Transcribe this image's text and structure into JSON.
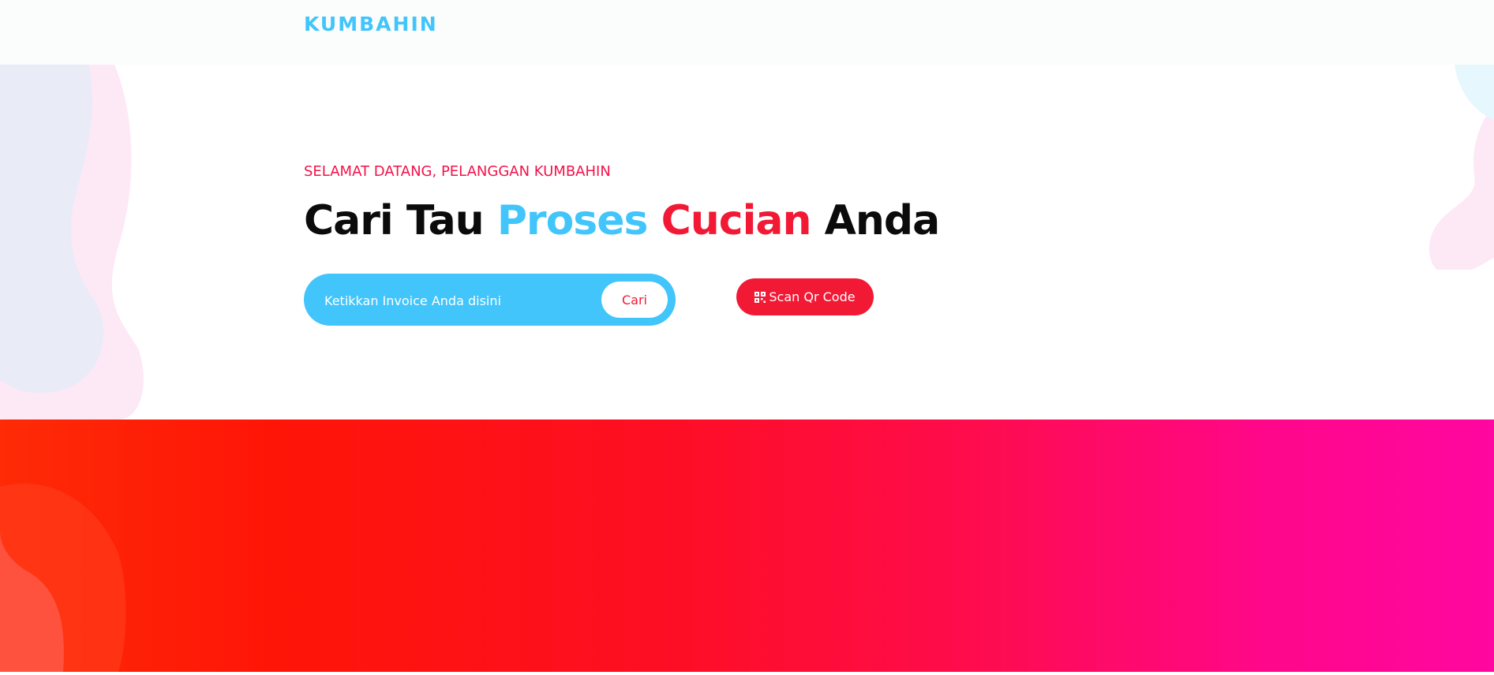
{
  "navbar": {
    "brand": "KUMBAHIN"
  },
  "hero": {
    "subtitle": "SELAMAT DATANG, PELANGGAN KUMBAHIN",
    "headline": {
      "part1": "Cari Tau",
      "part2": "Proses",
      "part3": "Cucian",
      "part4": "Anda"
    },
    "search": {
      "placeholder": "Ketikkan Invoice Anda disini",
      "value": "",
      "button_label": "Cari"
    },
    "scan_button": {
      "label": "Scan Qr Code",
      "icon": "qr-code-icon"
    }
  },
  "colors": {
    "brand_blue": "#41c5fb",
    "accent_red": "#f21935",
    "banner_gradient_start": "#fe2b06",
    "banner_gradient_end": "#ff07a0"
  }
}
